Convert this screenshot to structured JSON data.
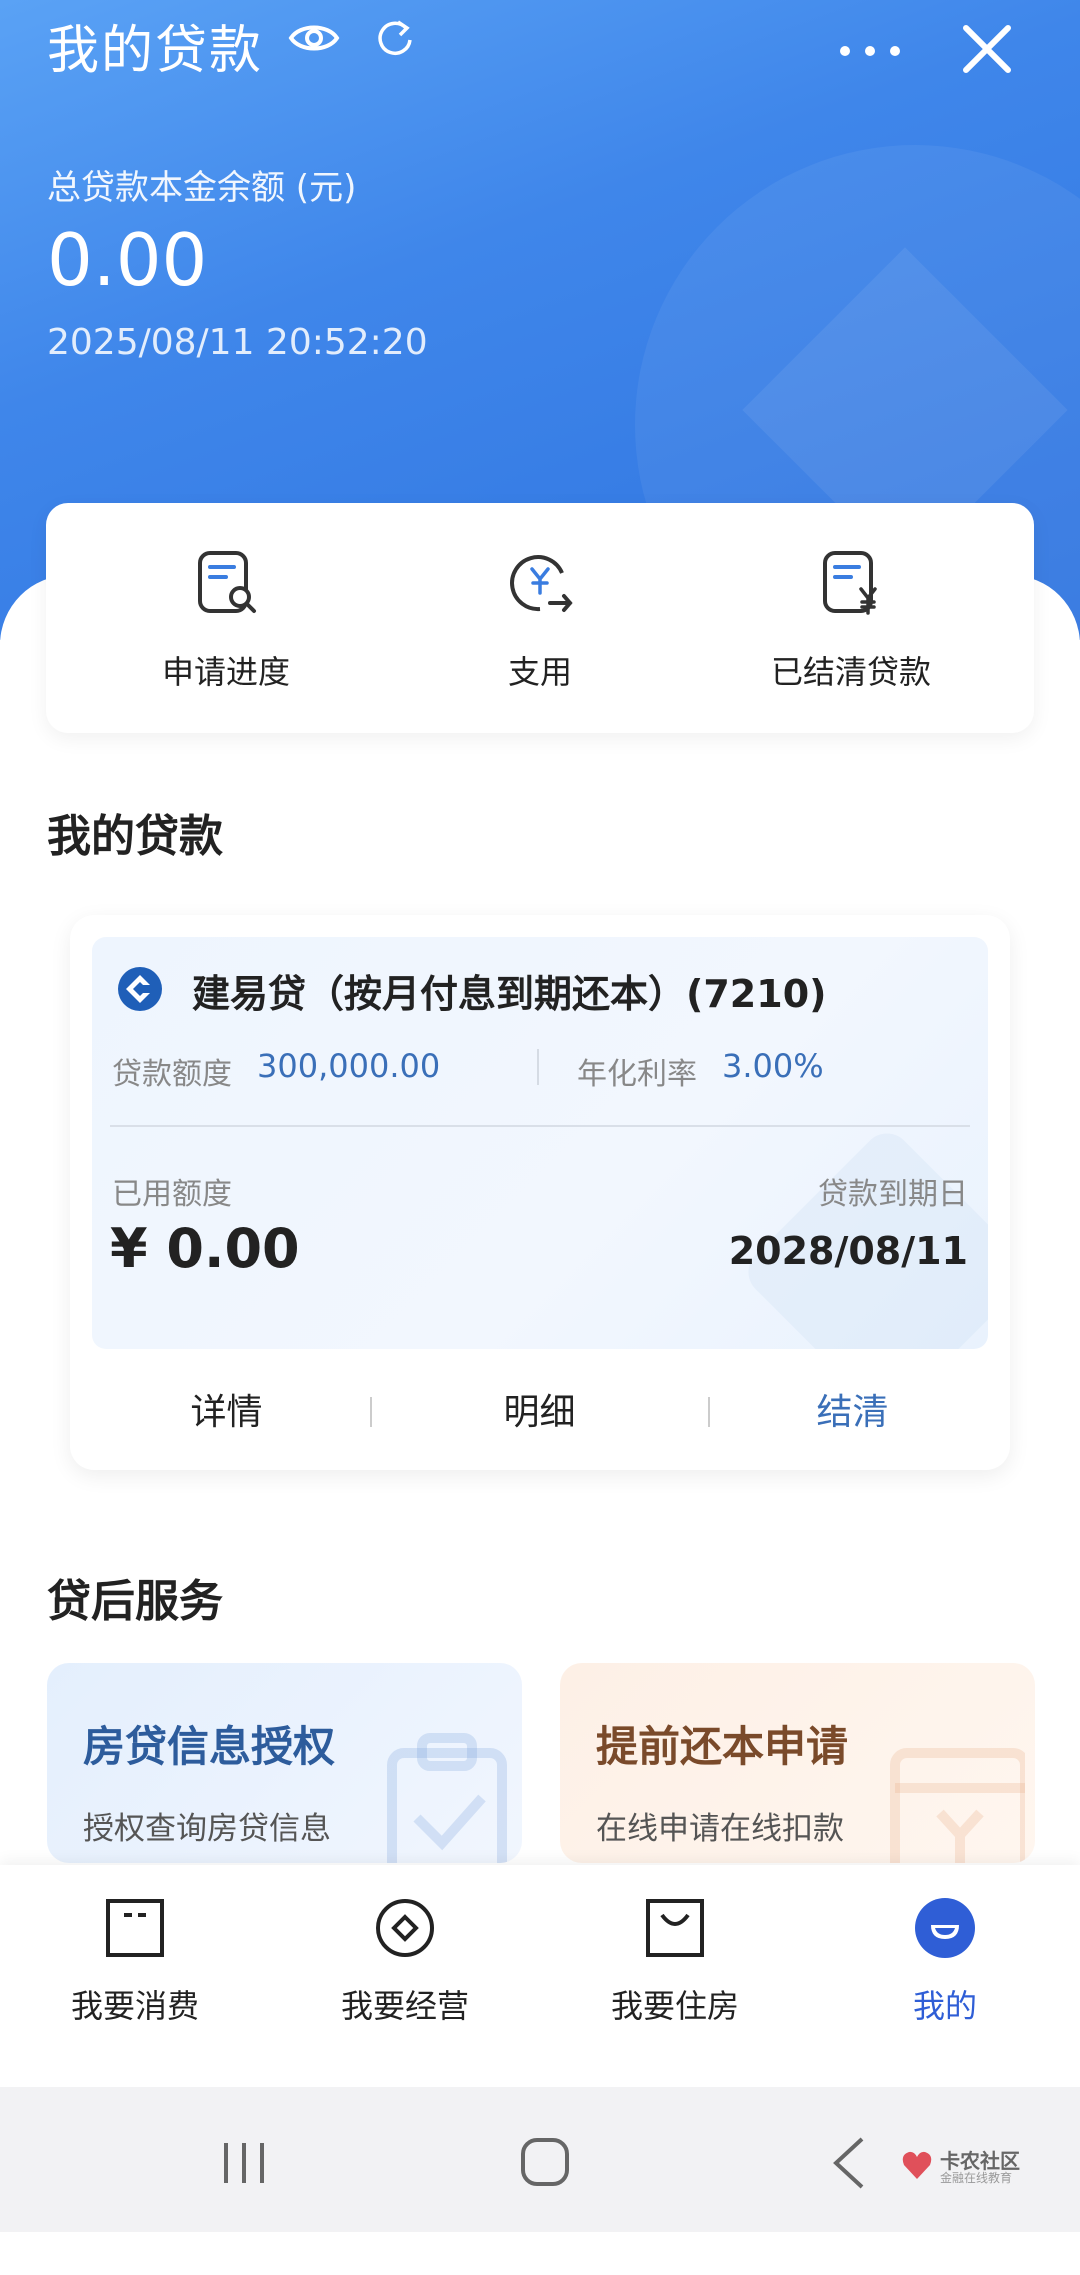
{
  "header": {
    "title": "我的贷款",
    "balance_label": "总贷款本金余额 (元)",
    "balance_value": "0.00",
    "timestamp": "2025/08/11 20:52:20"
  },
  "quick_actions": [
    {
      "label": "申请进度",
      "icon": "document-search-icon"
    },
    {
      "label": "支用",
      "icon": "yuan-transfer-icon"
    },
    {
      "label": "已结清贷款",
      "icon": "document-yuan-icon"
    }
  ],
  "my_loans": {
    "section_title": "我的贷款",
    "loan": {
      "name": "建易贷（按月付息到期还本）(7210)",
      "quota_label": "贷款额度",
      "quota_value": "300,000.00",
      "rate_label": "年化利率",
      "rate_value": "3.00%",
      "used_label": "已用额度",
      "used_value": "¥ 0.00",
      "due_label": "贷款到期日",
      "due_value": "2028/08/11",
      "tabs": [
        "详情",
        "明细",
        "结清"
      ]
    }
  },
  "after_service": {
    "section_title": "贷后服务",
    "cards": [
      {
        "title": "房贷信息授权",
        "desc": "授权查询房贷信息"
      },
      {
        "title": "提前还本申请",
        "desc": "在线申请在线扣款"
      }
    ]
  },
  "bottom_nav": [
    {
      "label": "我要消费",
      "icon": "wallet-icon",
      "active": false
    },
    {
      "label": "我要经营",
      "icon": "coin-icon",
      "active": false
    },
    {
      "label": "我要住房",
      "icon": "bag-icon",
      "active": false
    },
    {
      "label": "我的",
      "icon": "profile-icon",
      "active": true
    }
  ],
  "watermark": {
    "line1": "卡农社区",
    "line2": "金融在线教育"
  },
  "colors": {
    "header_blue": "#3f86ea",
    "link_blue": "#3a6fb8",
    "active_nav": "#2f5ed6"
  }
}
